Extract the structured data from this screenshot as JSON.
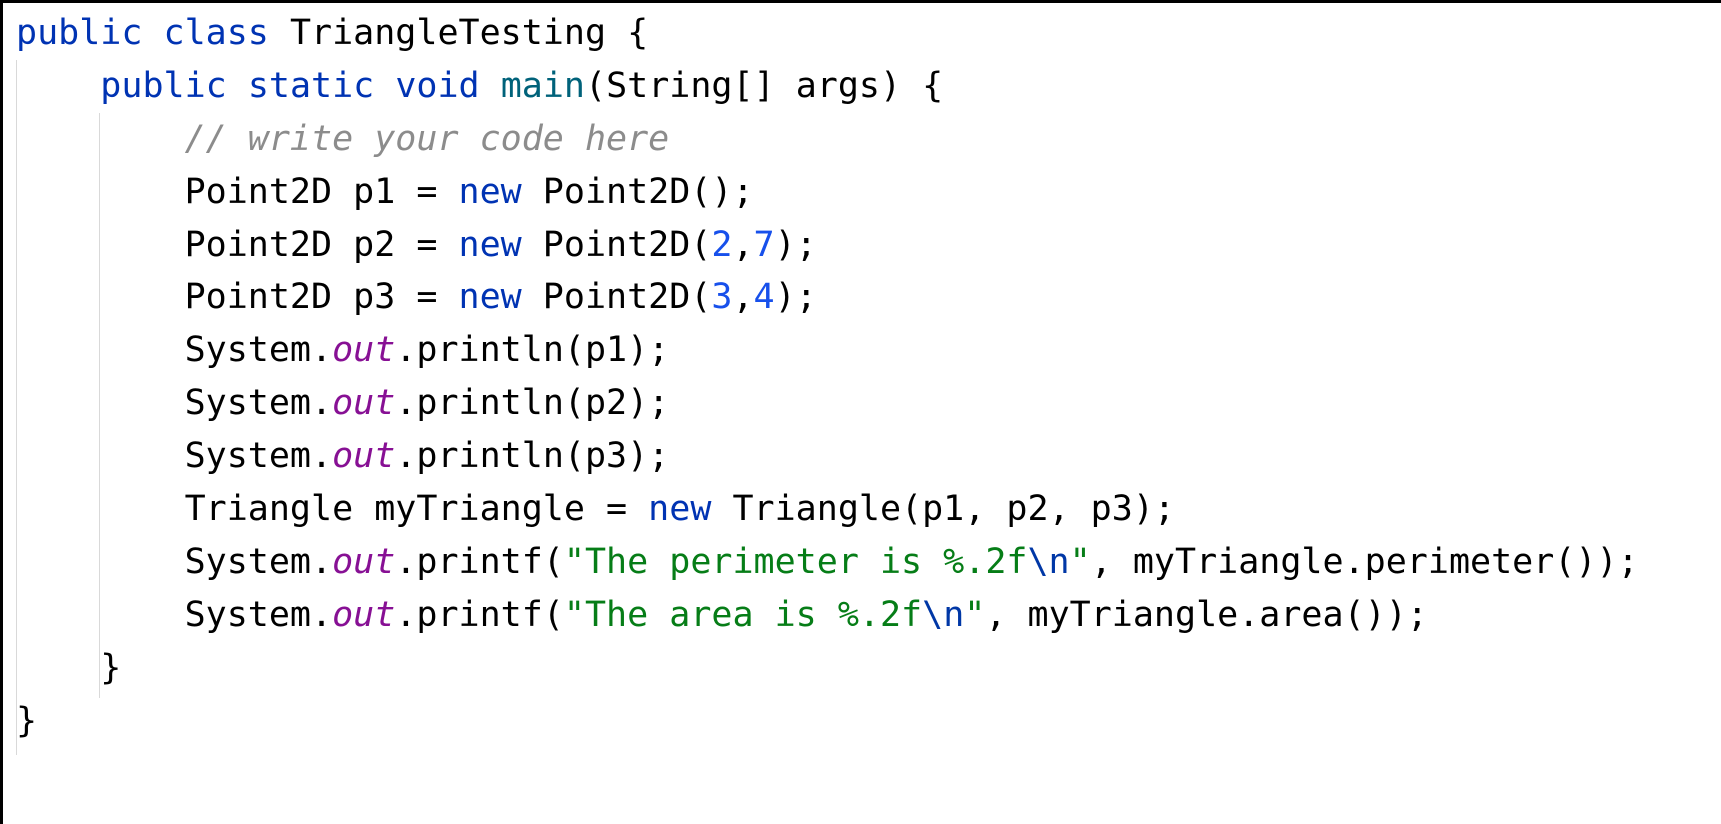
{
  "editor": {
    "language": "Java",
    "colors": {
      "keyword": "#0033b3",
      "method_declaration": "#00627a",
      "comment": "#8c8c8c",
      "number": "#1750eb",
      "static_field": "#871094",
      "string": "#067d17",
      "escape": "#0037a6",
      "plain": "#000000"
    },
    "lines": [
      {
        "indent": "",
        "tokens": [
          {
            "t": "public",
            "c": "kw"
          },
          {
            "t": " "
          },
          {
            "t": "class",
            "c": "kw"
          },
          {
            "t": " TriangleTesting {"
          }
        ]
      },
      {
        "indent": "    ",
        "tokens": [
          {
            "t": "public",
            "c": "kw"
          },
          {
            "t": " "
          },
          {
            "t": "static",
            "c": "kw"
          },
          {
            "t": " "
          },
          {
            "t": "void",
            "c": "kw"
          },
          {
            "t": " "
          },
          {
            "t": "main",
            "c": "fn"
          },
          {
            "t": "(String[] args) {"
          }
        ]
      },
      {
        "indent": "        ",
        "tokens": [
          {
            "t": "// write your code here",
            "c": "cm"
          }
        ]
      },
      {
        "indent": "        ",
        "tokens": [
          {
            "t": "Point2D p1 = "
          },
          {
            "t": "new",
            "c": "kw"
          },
          {
            "t": " Point2D();"
          }
        ]
      },
      {
        "indent": "        ",
        "tokens": [
          {
            "t": "Point2D p2 = "
          },
          {
            "t": "new",
            "c": "kw"
          },
          {
            "t": " Point2D("
          },
          {
            "t": "2",
            "c": "num"
          },
          {
            "t": ","
          },
          {
            "t": "7",
            "c": "num"
          },
          {
            "t": ");"
          }
        ]
      },
      {
        "indent": "        ",
        "tokens": [
          {
            "t": "Point2D p3 = "
          },
          {
            "t": "new",
            "c": "kw"
          },
          {
            "t": " Point2D("
          },
          {
            "t": "3",
            "c": "num"
          },
          {
            "t": ","
          },
          {
            "t": "4",
            "c": "num"
          },
          {
            "t": ");"
          }
        ]
      },
      {
        "indent": "        ",
        "tokens": [
          {
            "t": "System."
          },
          {
            "t": "out",
            "c": "fld"
          },
          {
            "t": ".println(p1);"
          }
        ]
      },
      {
        "indent": "        ",
        "tokens": [
          {
            "t": "System."
          },
          {
            "t": "out",
            "c": "fld"
          },
          {
            "t": ".println(p2);"
          }
        ]
      },
      {
        "indent": "        ",
        "tokens": [
          {
            "t": "System."
          },
          {
            "t": "out",
            "c": "fld"
          },
          {
            "t": ".println(p3);"
          }
        ]
      },
      {
        "indent": "        ",
        "tokens": [
          {
            "t": "Triangle myTriangle = "
          },
          {
            "t": "new",
            "c": "kw"
          },
          {
            "t": " Triangle(p1, p2, p3);"
          }
        ]
      },
      {
        "indent": "        ",
        "tokens": [
          {
            "t": "System."
          },
          {
            "t": "out",
            "c": "fld"
          },
          {
            "t": ".printf("
          },
          {
            "t": "\"The perimeter is %.2f",
            "c": "str"
          },
          {
            "t": "\\n",
            "c": "esc"
          },
          {
            "t": "\"",
            "c": "str"
          },
          {
            "t": ", myTriangle.perimeter());"
          }
        ]
      },
      {
        "indent": "        ",
        "tokens": [
          {
            "t": "System."
          },
          {
            "t": "out",
            "c": "fld"
          },
          {
            "t": ".printf("
          },
          {
            "t": "\"The area is %.2f",
            "c": "str"
          },
          {
            "t": "\\n",
            "c": "esc"
          },
          {
            "t": "\"",
            "c": "str"
          },
          {
            "t": ", myTriangle.area());"
          }
        ]
      },
      {
        "indent": "    ",
        "tokens": [
          {
            "t": "}"
          }
        ]
      },
      {
        "indent": "",
        "tokens": [
          {
            "t": "}"
          }
        ]
      }
    ]
  }
}
